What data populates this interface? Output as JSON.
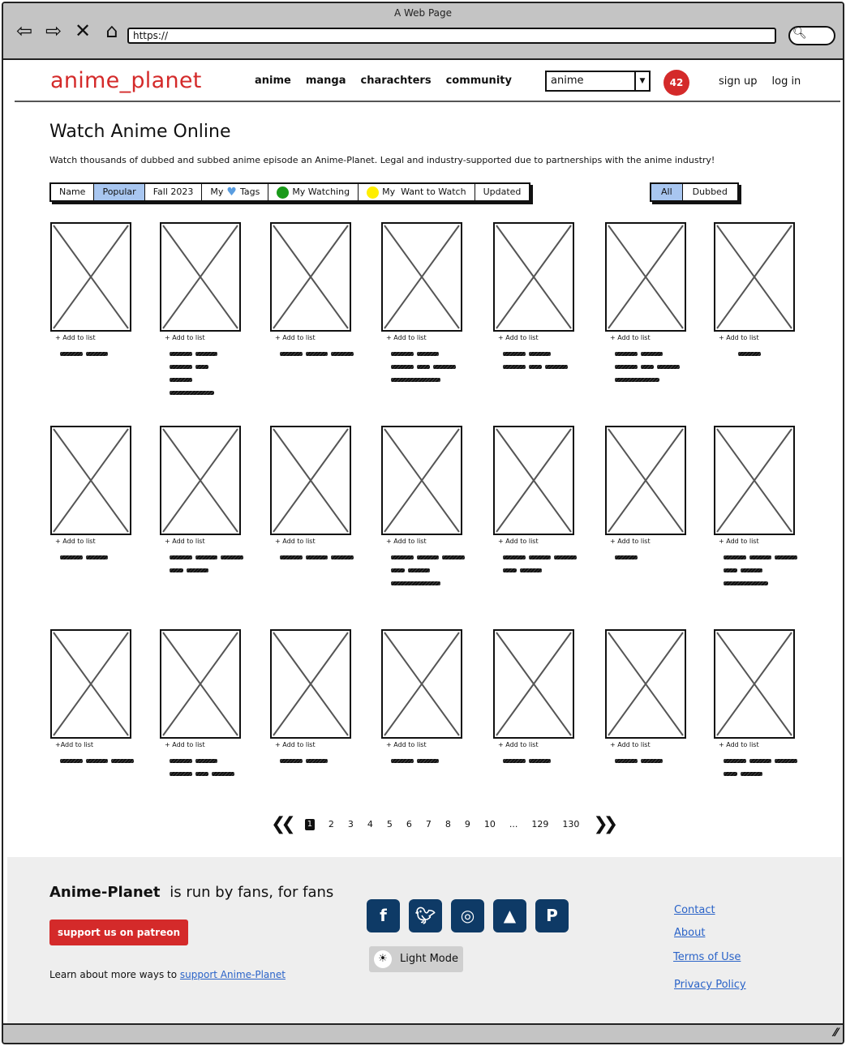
{
  "browser": {
    "title": "A Web Page",
    "url": "https://",
    "icons": [
      "back-arrow-icon",
      "forward-arrow-icon",
      "close-icon",
      "home-icon",
      "search-icon"
    ]
  },
  "header": {
    "logo": "anime_planet",
    "nav": [
      "anime",
      "manga",
      "charachters",
      "community"
    ],
    "search_select": "anime",
    "notification_count": "42",
    "sign_up": "sign up",
    "log_in": "log in"
  },
  "main": {
    "title": "Watch Anime Online",
    "description": "Watch thousands of dubbed and subbed anime episode an Anime-Planet. Legal and industry-supported due to partnerships with the anime industry!",
    "filter_tabs": {
      "name": "Name",
      "popular": "Popular",
      "fall": "Fall 2023",
      "my_tags_pre": "My",
      "my_tags_post": "Tags",
      "watching": "My Watching",
      "want": "My  Want to Watch",
      "updated": "Updated"
    },
    "active_tab": "Popular",
    "colors": {
      "watching": "#1a9a1a",
      "want": "#ffee00",
      "heart": "#5a9de0",
      "accent": "#d42a2a",
      "active": "#a8c6f0"
    },
    "audio_toggle": {
      "all": "All",
      "dubbed": "Dubbed"
    },
    "active_audio": "All",
    "cards": [
      {
        "add": "+ Add to list"
      },
      {
        "add": "+ Add to list"
      },
      {
        "add": "+ Add to list"
      },
      {
        "add": "+ Add to list"
      },
      {
        "add": "+ Add to list"
      },
      {
        "add": "+ Add to list"
      },
      {
        "add": "+ Add to list"
      },
      {
        "add": "+ Add to list"
      },
      {
        "add": "+ Add to list"
      },
      {
        "add": "+ Add to list"
      },
      {
        "add": "+ Add to list"
      },
      {
        "add": "+ Add to list"
      },
      {
        "add": "+ Add to list"
      },
      {
        "add": "+ Add to list"
      },
      {
        "add": "+Add to list"
      },
      {
        "add": "+ Add to list"
      },
      {
        "add": "+ Add to list"
      },
      {
        "add": "+ Add to list"
      },
      {
        "add": "+ Add to list"
      },
      {
        "add": "+ Add to list"
      },
      {
        "add": "+ Add to list"
      }
    ]
  },
  "pagination": {
    "current": "1",
    "pages": [
      "2",
      "3",
      "4",
      "5",
      "6",
      "7",
      "8",
      "9",
      "10",
      "...",
      "129",
      "130"
    ]
  },
  "footer": {
    "brand": "Anime-Planet",
    "tagline": "is run by fans, for fans",
    "patreon_button": "support us on patreon",
    "learn_text": "Learn about more ways to",
    "learn_link": "support Anime-Planet",
    "socials": [
      "facebook-icon",
      "twitter-icon",
      "instagram-icon",
      "android-icon",
      "paypal-icon"
    ],
    "light_mode": "Light Mode",
    "links": [
      "Contact",
      "About",
      "Terms of Use",
      "Privacy Policy"
    ]
  }
}
